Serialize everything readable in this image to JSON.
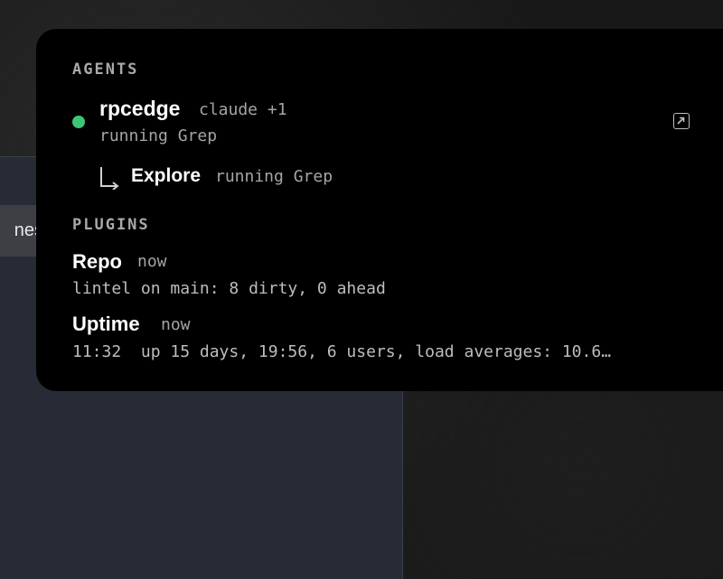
{
  "background": {
    "tab_fragment": "nes"
  },
  "agents": {
    "heading": "AGENTS",
    "items": [
      {
        "name": "rpcedge",
        "meta": "claude +1",
        "status": "running Grep",
        "status_color": "#3ec477",
        "subagent": {
          "name": "Explore",
          "status": "running Grep"
        }
      }
    ]
  },
  "plugins": {
    "heading": "PLUGINS",
    "items": [
      {
        "name": "Repo",
        "time": "now",
        "detail": "lintel on main: 8 dirty, 0 ahead"
      },
      {
        "name": "Uptime",
        "time": "now",
        "detail": "11:32  up 15 days, 19:56, 6 users, load averages: 10.6…"
      }
    ]
  },
  "icons": {
    "open": "open-external-icon",
    "subagent": "subagent-arrow-icon",
    "status": "status-dot-icon"
  }
}
